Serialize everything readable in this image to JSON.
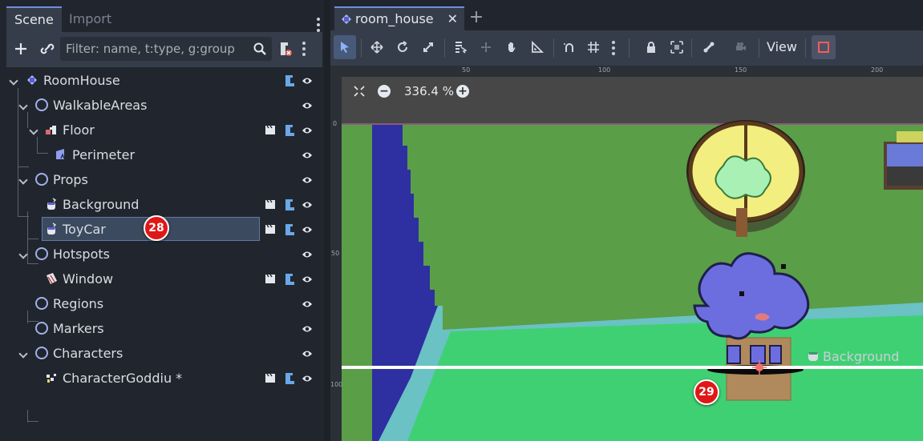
{
  "dock": {
    "tabs": {
      "scene": "Scene",
      "import": "Import"
    },
    "filter_placeholder": "Filter: name, t:type, g:group",
    "tree": [
      {
        "label": "RoomHouse",
        "has_script": true,
        "has_scene": false
      },
      {
        "label": "WalkableAreas",
        "has_script": false,
        "has_scene": false
      },
      {
        "label": "Floor",
        "has_script": true,
        "has_scene": true
      },
      {
        "label": "Perimeter",
        "has_script": false,
        "has_scene": false
      },
      {
        "label": "Props",
        "has_script": false,
        "has_scene": false
      },
      {
        "label": "Background",
        "has_script": true,
        "has_scene": true
      },
      {
        "label": "ToyCar",
        "has_script": true,
        "has_scene": true,
        "selected": true
      },
      {
        "label": "Hotspots",
        "has_script": false,
        "has_scene": false
      },
      {
        "label": "Window",
        "has_script": true,
        "has_scene": true
      },
      {
        "label": "Regions",
        "has_script": false,
        "has_scene": false
      },
      {
        "label": "Markers",
        "has_script": false,
        "has_scene": false
      },
      {
        "label": "Characters",
        "has_script": false,
        "has_scene": false
      },
      {
        "label": "CharacterGoddiu *",
        "has_script": true,
        "has_scene": true
      }
    ]
  },
  "badges": {
    "left": "28",
    "canvas": "29"
  },
  "editor": {
    "tab_label": "room_house",
    "close_glyph": "✕",
    "add_tab_glyph": "+",
    "view_menu": "View",
    "zoom": "336.4 %",
    "ruler_top": [
      "50",
      "100",
      "150",
      "200"
    ],
    "ruler_left": [
      "0",
      "50",
      "100"
    ],
    "background_label": "Background"
  },
  "colors": {
    "accent": "#6f8fdc",
    "badge": "#e01717",
    "grass": "#5a9e48",
    "floor": "#40d074",
    "wall_blue": "#2e2fa0",
    "character": "#6c6ee0"
  }
}
